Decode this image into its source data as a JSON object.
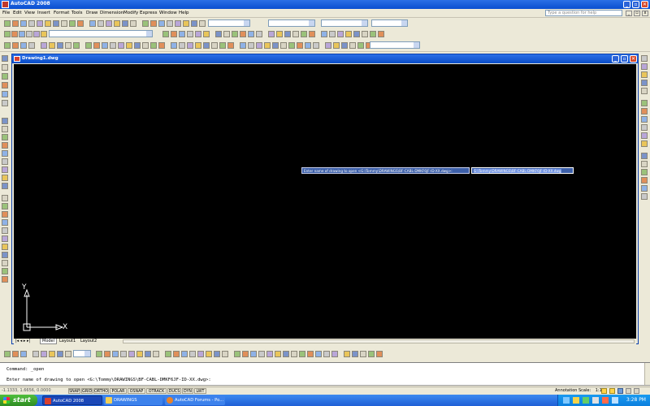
{
  "app": {
    "title": "AutoCAD 2008"
  },
  "menu": {
    "items": [
      "File",
      "Edit",
      "View",
      "Insert",
      "Format",
      "Tools",
      "Draw",
      "Dimension",
      "Modify",
      "Express",
      "Window",
      "Help"
    ],
    "help_placeholder": "Type a question for help"
  },
  "document": {
    "title": "Drawing1.dwg"
  },
  "dynamic_input": {
    "prompt": "Enter name of drawing to open <G:\\Tommy\\DRAWINGS\\BF-CABL-DMKF6JF-ID-XX.dwg>:",
    "value": "G:\\Tommy\\DRAWINGS\\BF-CABL-DMKF6JF-ID-XX.dwg"
  },
  "ucs": {
    "x_label": "X",
    "y_label": "Y"
  },
  "layout_tabs": [
    "Model",
    "Layout1",
    "Layout2"
  ],
  "command_line": {
    "history": "Command: _open",
    "current": "Enter name of drawing to open <G:\\Tommy\\DRAWINGS\\BF-CABL-DMKF6JF-ID-XX.dwg>:"
  },
  "status_bar": {
    "coords": "-1.1333, 1.6656, 0.0000",
    "toggles": [
      "SNAP",
      "GRID",
      "ORTHO",
      "POLAR",
      "OSNAP",
      "OTRACK",
      "DUCS",
      "DYN",
      "LWT"
    ],
    "annotation_scale_label": "Annotation Scale:",
    "annotation_scale_value": "1:1"
  },
  "taskbar": {
    "start_label": "start",
    "tasks": [
      "AutoCAD 2008",
      "DRAWINGS",
      "AutoCAD Forums - Po..."
    ],
    "clock": "3:28 PM"
  },
  "colors": {
    "title_blue": "#0a4fd0",
    "canvas": "#000000",
    "taskbar": "#245edb",
    "start_green": "#3a9a2c",
    "dynamic_input_bg": "#3c5fa8"
  }
}
